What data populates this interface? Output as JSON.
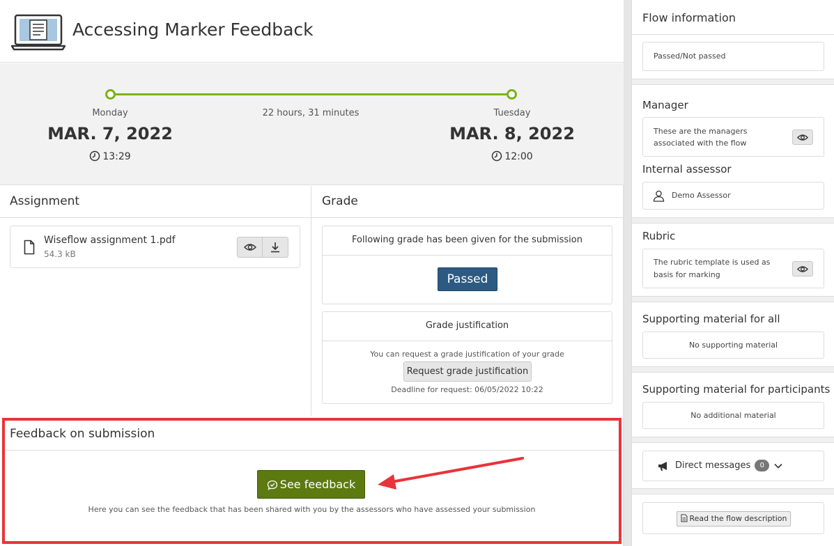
{
  "header": {
    "title": "Accessing Marker Feedback",
    "icon": "laptop-icon"
  },
  "timeline": {
    "start": {
      "day": "Monday",
      "date": "MAR. 7, 2022",
      "time": "13:29"
    },
    "end": {
      "day": "Tuesday",
      "date": "MAR. 8, 2022",
      "time": "12:00"
    },
    "duration": "22 hours, 31 minutes",
    "accent": "#7ab317"
  },
  "assignment": {
    "title": "Assignment",
    "file": {
      "name": "Wiseflow assignment 1.pdf",
      "size": "54.3 kB"
    }
  },
  "grade": {
    "title": "Grade",
    "given_text": "Following grade has been given for the submission",
    "value": "Passed",
    "justification": {
      "title": "Grade justification",
      "info": "You can request a grade justification of your grade",
      "button": "Request grade justification",
      "deadline": "Deadline for request: 06/05/2022 10:22"
    }
  },
  "feedback": {
    "title": "Feedback on submission",
    "button": "See feedback",
    "description": "Here you can see the feedback that has been shared with you by the assessors who have assessed your submission",
    "highlight_color": "#e8343a"
  },
  "sidebar": {
    "title": "Flow information",
    "type": "Passed/Not passed",
    "manager": {
      "title": "Manager",
      "text": "These are the managers associated with the flow"
    },
    "internal_assessor": {
      "title": "Internal assessor",
      "name": "Demo Assessor"
    },
    "rubric": {
      "title": "Rubric",
      "text": "The rubric template is used as basis for marking"
    },
    "support_all": {
      "title": "Supporting material for all",
      "text": "No supporting material"
    },
    "support_participants": {
      "title": "Supporting material for participants",
      "text": "No additional material"
    },
    "messages": {
      "label": "Direct messages",
      "count": "0"
    },
    "description_button": "Read the flow description"
  }
}
